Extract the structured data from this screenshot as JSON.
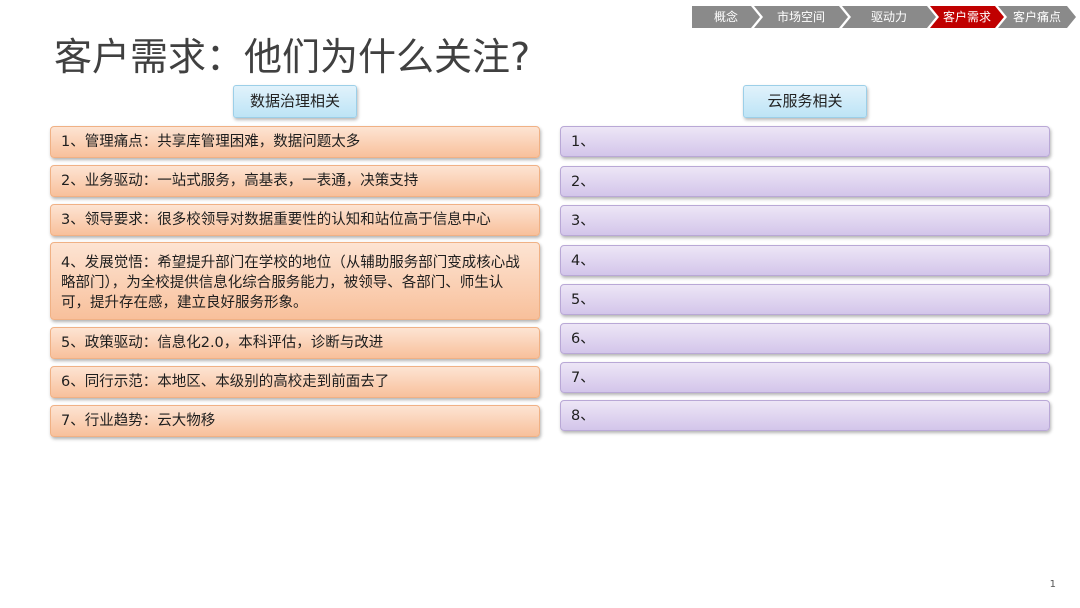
{
  "nav": [
    {
      "label": "概念",
      "active": false
    },
    {
      "label": "市场空间",
      "active": false
    },
    {
      "label": "驱动力",
      "active": false
    },
    {
      "label": "客户需求",
      "active": true
    },
    {
      "label": "客户痛点",
      "active": false
    }
  ],
  "title": "客户需求：他们为什么关注?",
  "left": {
    "header": "数据治理相关",
    "items": [
      "1、管理痛点：共享库管理困难，数据问题太多",
      "2、业务驱动：一站式服务，高基表，一表通，决策支持",
      "3、领导要求：很多校领导对数据重要性的认知和站位高于信息中心",
      "4、发展觉悟：希望提升部门在学校的地位（从辅助服务部门变成核心战略部门），为全校提供信息化综合服务能力，被领导、各部门、师生认可，提升存在感，建立良好服务形象。",
      "5、政策驱动：信息化2.0，本科评估，诊断与改进",
      "6、同行示范：本地区、本级别的高校走到前面去了",
      "7、行业趋势：云大物移"
    ]
  },
  "right": {
    "header": "云服务相关",
    "items": [
      "1、",
      "2、",
      "3、",
      "4、",
      "5、",
      "6、",
      "7、",
      "8、"
    ]
  },
  "page_number": "1",
  "colors": {
    "nav_active": "#c00000",
    "nav_inactive": "#8a8a8a",
    "orange_box": "#f8c09b",
    "purple_box": "#d3c5ea",
    "header_box": "#bde4f6"
  }
}
